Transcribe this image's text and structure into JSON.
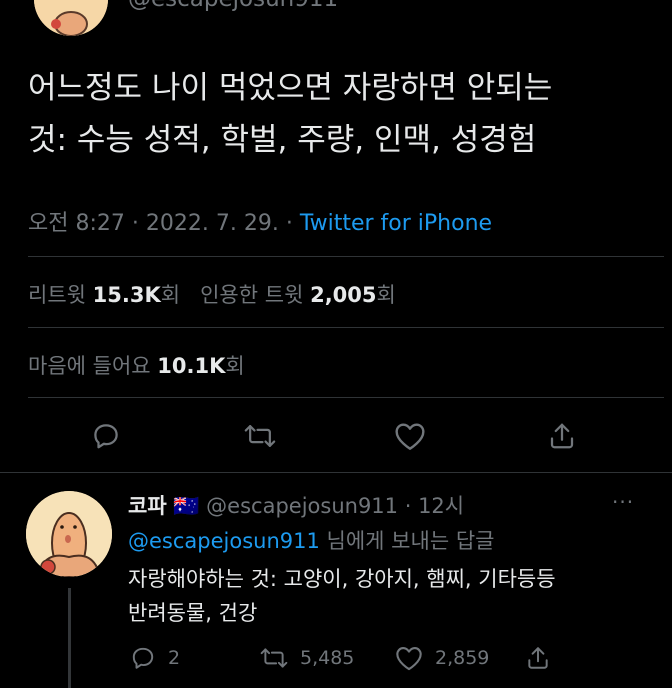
{
  "header": {
    "handle_partial": "@escapejosun911"
  },
  "tweet": {
    "text_line1": "어느정도 나이 먹었으면 자랑하면 안되는",
    "text_line2": "것: 수능 성적, 학벌, 주량, 인맥, 성경험",
    "time": "오전 8:27",
    "separator": " · ",
    "date": "2022. 7. 29.",
    "separator2": " · ",
    "source": "Twitter for iPhone",
    "retweets_label": "리트윗",
    "retweets_count": "15.3K",
    "retweets_unit": "회",
    "quotes_label": "인용한 트윗",
    "quotes_count": "2,005",
    "quotes_unit": "회",
    "likes_label": "마음에 들어요",
    "likes_count": "10.1K",
    "likes_unit": "회"
  },
  "actions": {
    "reply_icon": "reply-icon",
    "retweet_icon": "retweet-icon",
    "like_icon": "heart-icon",
    "share_icon": "share-icon"
  },
  "reply": {
    "name": "코파",
    "flag": "🇦🇺",
    "handle": "@escapejosun911",
    "dot": " · ",
    "time": "12시",
    "more": "···",
    "replying_to": "@escapejosun911",
    "replying_suffix": "님에게 보내는 답글",
    "text_line1": "자랑해야하는 것: 고양이, 강아지, 햄찌, 기타등등",
    "text_line2": "반려동물, 건강",
    "reply_count": "2",
    "retweet_count": "5,485",
    "like_count": "2,859"
  },
  "colors": {
    "background": "#000000",
    "text": "#e7e9ea",
    "muted": "#71767b",
    "link": "#1d9bf0",
    "divider": "#2f3336"
  }
}
